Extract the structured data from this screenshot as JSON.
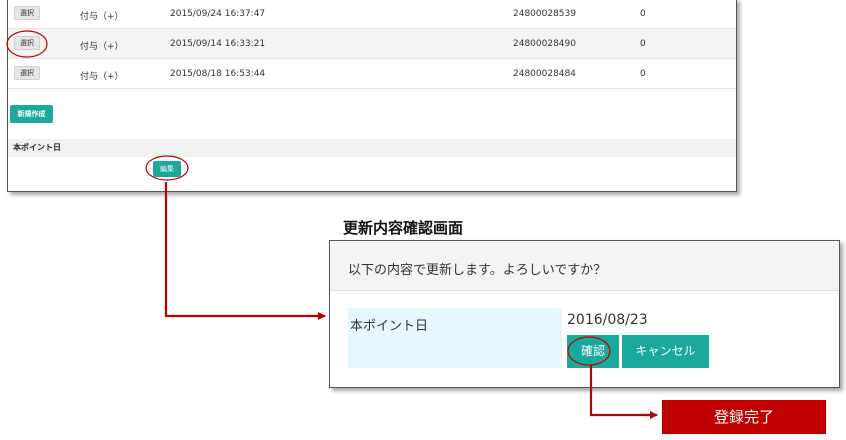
{
  "list": {
    "rows": [
      {
        "select_label": "選択",
        "type": "付与（+）",
        "datetime": "2015/09/24 16:37:47",
        "id": "24800028539",
        "points": "0"
      },
      {
        "select_label": "選択",
        "type": "付与（+）",
        "datetime": "2015/09/14 16:33:21",
        "id": "24800028490",
        "points": "0"
      },
      {
        "select_label": "選択",
        "type": "付与（+）",
        "datetime": "2015/08/18 16:53:44",
        "id": "24800028484",
        "points": "0"
      }
    ],
    "new_button": "新規作成",
    "section_label": "本ポイント日",
    "edit_button": "編集"
  },
  "annotation": {
    "screen_caption": "更新内容確認画面",
    "result_label": "登録完了",
    "accent_color": "#c00000"
  },
  "dialog": {
    "message": "以下の内容で更新します。よろしいですか？",
    "field_label": "本ポイント日",
    "field_value": "2016/08/23",
    "confirm_button": "確認",
    "cancel_button": "キャンセル"
  },
  "colors": {
    "button_teal": "#1aa99a",
    "highlight_cell": "#e8f6fd"
  }
}
